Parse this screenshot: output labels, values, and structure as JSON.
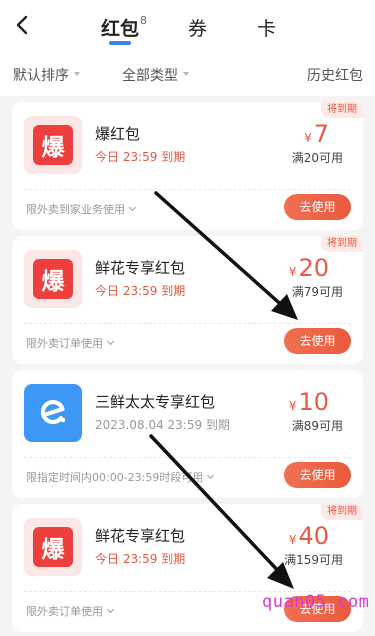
{
  "header": {
    "tabs": [
      {
        "label": "红包",
        "count": "8"
      },
      {
        "label": "券"
      },
      {
        "label": "卡"
      }
    ]
  },
  "filters": {
    "sort": "默认排序",
    "type": "全部类型",
    "history": "历史红包"
  },
  "coupons": [
    {
      "title": "爆红包",
      "subtitle": "今日 23:59 到期",
      "currency": "¥",
      "amount": "7",
      "condition": "满20可用",
      "limit": "限外卖到家业务使用",
      "tag": "将到期",
      "button": "去使用",
      "logo_text": "爆"
    },
    {
      "title": "鲜花专享红包",
      "subtitle": "今日 23:59 到期",
      "currency": "¥",
      "amount": "20",
      "condition": "满79可用",
      "limit": "限外卖订单使用",
      "tag": "将到期",
      "button": "去使用",
      "logo_text": "爆"
    },
    {
      "title": "三鲜太太专享红包",
      "subtitle": "2023.08.04 23:59 到期",
      "currency": "¥",
      "amount": "10",
      "condition": "满89可用",
      "limit": "限指定时间内00:00-23:59时段可用",
      "tag": "",
      "button": "去使用",
      "logo_text": ""
    },
    {
      "title": "鲜花专享红包",
      "subtitle": "今日 23:59 到期",
      "currency": "¥",
      "amount": "40",
      "condition": "满159可用",
      "limit": "限外卖订单使用",
      "tag": "将到期",
      "button": "去使用",
      "logo_text": "爆"
    }
  ],
  "watermark": "quan05.com",
  "colors": {
    "accent": "#ea5a43",
    "tab_underline": "#3b82f6",
    "brand_blue": "#3d97f4"
  },
  "icons": {
    "back": "back-chevron-icon",
    "bao": "bao-logo-icon",
    "eleme": "eleme-logo-icon"
  }
}
